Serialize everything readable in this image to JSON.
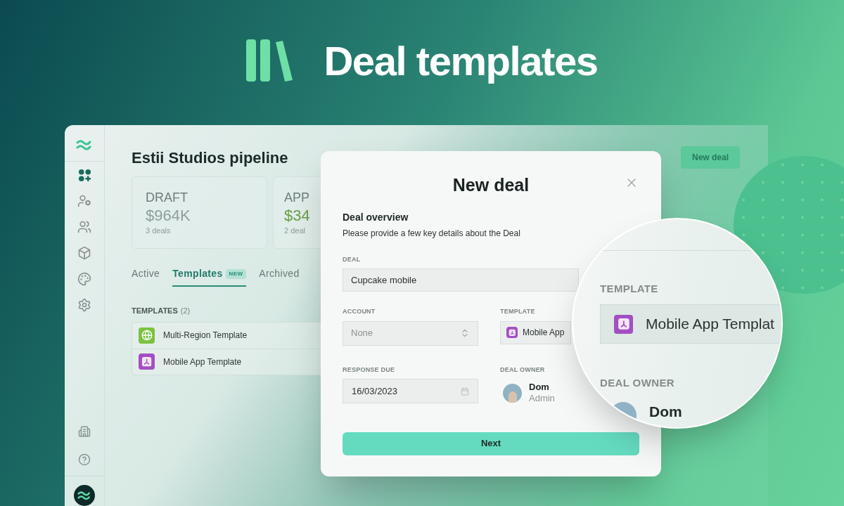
{
  "headline": {
    "title": "Deal templates"
  },
  "sidebar": {
    "items": [
      {
        "selected": true
      },
      {
        "selected": false
      },
      {
        "selected": false
      },
      {
        "selected": false
      },
      {
        "selected": false
      },
      {
        "selected": false
      }
    ]
  },
  "page": {
    "title": "Estii Studios pipeline",
    "header_button": "New deal"
  },
  "stats": [
    {
      "label": "DRAFT",
      "amount": "$964K",
      "count": "3 deals",
      "color": "#8f9e9c"
    },
    {
      "label": "APP",
      "amount": "$34",
      "count": "2 deal",
      "color": "#6b9e45"
    }
  ],
  "tabs": [
    {
      "label": "Active",
      "selected": false
    },
    {
      "label": "Templates",
      "selected": true,
      "badge": "NEW"
    },
    {
      "label": "Archived",
      "selected": false
    }
  ],
  "templates": {
    "heading": "TEMPLATES",
    "count": "(2)",
    "items": [
      {
        "name": "Multi-Region Template",
        "color": "#7cc242"
      },
      {
        "name": "Mobile App Template",
        "color": "#a34fc2"
      }
    ]
  },
  "modal": {
    "title": "New deal",
    "section_title": "Deal overview",
    "description": "Please provide a few key details about the Deal",
    "deal": {
      "label": "DEAL",
      "value": "Cupcake mobile"
    },
    "account": {
      "label": "ACCOUNT",
      "value": "None"
    },
    "template": {
      "label": "TEMPLATE",
      "value": "Mobile App",
      "color": "#a34fc2"
    },
    "response_due": {
      "label": "RESPONSE DUE",
      "value": "16/03/2023"
    },
    "owner": {
      "label": "DEAL OWNER",
      "name": "Dom",
      "role": "Admin"
    },
    "button": "Next"
  },
  "magnifier": {
    "template": {
      "label": "TEMPLATE",
      "value": "Mobile App Templat",
      "color": "#a34fc2"
    },
    "owner": {
      "label": "DEAL OWNER",
      "name": "Dom"
    }
  }
}
